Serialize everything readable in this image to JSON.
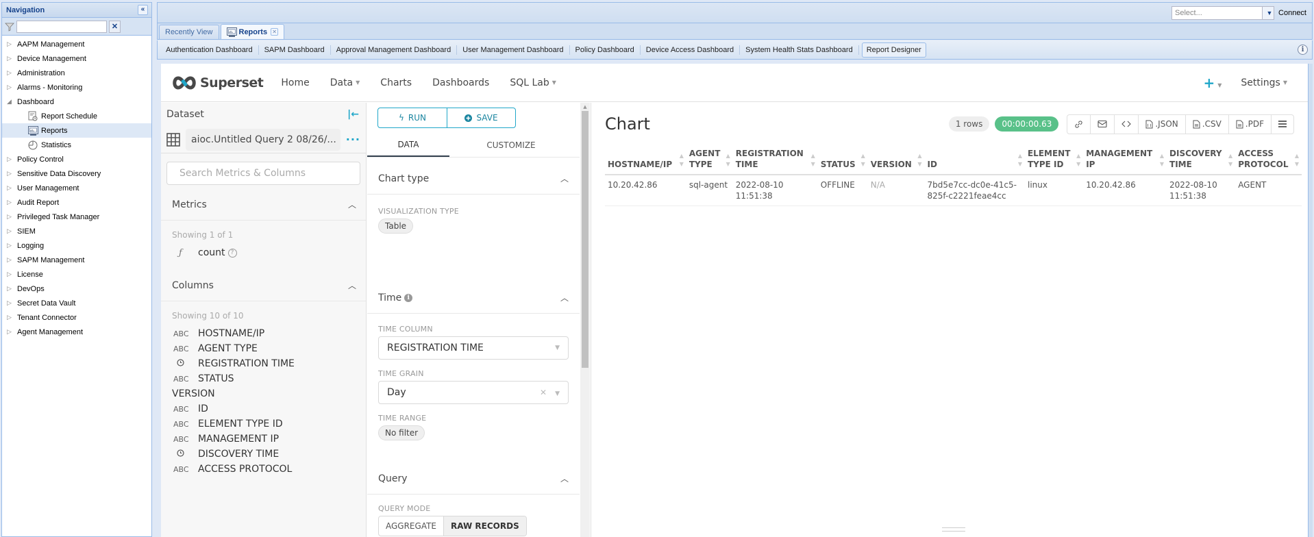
{
  "navigation": {
    "title": "Navigation",
    "filter_placeholder": "",
    "items": [
      {
        "label": "AAPM Management",
        "expanded": false
      },
      {
        "label": "Device Management",
        "expanded": false
      },
      {
        "label": "Administration",
        "expanded": false
      },
      {
        "label": "Alarms - Monitoring",
        "expanded": false
      },
      {
        "label": "Dashboard",
        "expanded": true,
        "children": [
          {
            "label": "Report Schedule",
            "icon": "report-schedule-icon"
          },
          {
            "label": "Reports",
            "icon": "reports-icon",
            "selected": true
          },
          {
            "label": "Statistics",
            "icon": "statistics-icon"
          }
        ]
      },
      {
        "label": "Policy Control",
        "expanded": false
      },
      {
        "label": "Sensitive Data Discovery",
        "expanded": false
      },
      {
        "label": "User Management",
        "expanded": false
      },
      {
        "label": "Audit Report",
        "expanded": false
      },
      {
        "label": "Privileged Task Manager",
        "expanded": false
      },
      {
        "label": "SIEM",
        "expanded": false
      },
      {
        "label": "Logging",
        "expanded": false
      },
      {
        "label": "SAPM Management",
        "expanded": false
      },
      {
        "label": "License",
        "expanded": false
      },
      {
        "label": "DevOps",
        "expanded": false
      },
      {
        "label": "Secret Data Vault",
        "expanded": false
      },
      {
        "label": "Tenant Connector",
        "expanded": false
      },
      {
        "label": "Agent Management",
        "expanded": false
      }
    ]
  },
  "topbar": {
    "select_placeholder": "Select...",
    "connect_label": "Connect"
  },
  "tabs": [
    {
      "label": "Recently View",
      "active": false
    },
    {
      "label": "Reports",
      "active": true,
      "closable": true
    }
  ],
  "subtabs": [
    {
      "label": "Authentication Dashboard"
    },
    {
      "label": "SAPM Dashboard"
    },
    {
      "label": "Approval Management Dashboard"
    },
    {
      "label": "User Management Dashboard"
    },
    {
      "label": "Policy Dashboard"
    },
    {
      "label": "Device Access Dashboard"
    },
    {
      "label": "System Health Stats Dashboard"
    },
    {
      "label": "Report Designer",
      "active": true
    }
  ],
  "superset": {
    "logo_text": "Superset",
    "menu": [
      {
        "label": "Home",
        "dropdown": false
      },
      {
        "label": "Data",
        "dropdown": true
      },
      {
        "label": "Charts",
        "dropdown": false
      },
      {
        "label": "Dashboards",
        "dropdown": false
      },
      {
        "label": "SQL Lab",
        "dropdown": true
      }
    ],
    "settings_label": "Settings",
    "accent_color": "#20a7c9"
  },
  "dataset": {
    "title": "Dataset",
    "name": "aioc.Untitled Query 2 08/26/...",
    "search_placeholder": "Search Metrics & Columns",
    "metrics": {
      "title": "Metrics",
      "showing": "Showing 1 of 1",
      "items": [
        {
          "type": "f",
          "label": "count"
        }
      ]
    },
    "columns": {
      "title": "Columns",
      "showing": "Showing 10 of 10",
      "items": [
        {
          "type": "ABC",
          "label": "HOSTNAME/IP"
        },
        {
          "type": "ABC",
          "label": "AGENT TYPE"
        },
        {
          "type": "clock",
          "label": "REGISTRATION TIME"
        },
        {
          "type": "ABC",
          "label": "STATUS"
        },
        {
          "type": "",
          "label": "VERSION"
        },
        {
          "type": "ABC",
          "label": "ID"
        },
        {
          "type": "ABC",
          "label": "ELEMENT TYPE ID"
        },
        {
          "type": "ABC",
          "label": "MANAGEMENT IP"
        },
        {
          "type": "clock",
          "label": "DISCOVERY TIME"
        },
        {
          "type": "ABC",
          "label": "ACCESS PROTOCOL"
        }
      ]
    }
  },
  "controls": {
    "run_label": "RUN",
    "save_label": "SAVE",
    "tabs": [
      {
        "label": "DATA",
        "active": true
      },
      {
        "label": "CUSTOMIZE",
        "active": false
      }
    ],
    "chart_type": {
      "title": "Chart type",
      "viz_label": "VISUALIZATION TYPE",
      "viz_value": "Table"
    },
    "time": {
      "title": "Time",
      "time_column_label": "TIME COLUMN",
      "time_column_value": "REGISTRATION TIME",
      "time_grain_label": "TIME GRAIN",
      "time_grain_value": "Day",
      "time_range_label": "TIME RANGE",
      "time_range_value": "No filter"
    },
    "query": {
      "title": "Query",
      "mode_label": "QUERY MODE",
      "modes": [
        {
          "label": "AGGREGATE",
          "active": false
        },
        {
          "label": "RAW RECORDS",
          "active": true
        }
      ]
    }
  },
  "chart": {
    "title": "Chart",
    "rows_badge": "1 rows",
    "time_badge": "00:00:00.63",
    "time_badge_color": "#59c189",
    "tools": [
      {
        "icon": "link-icon",
        "label": ""
      },
      {
        "icon": "email-icon",
        "label": ""
      },
      {
        "icon": "embed-code-icon",
        "label": ""
      },
      {
        "icon": "json-file-icon",
        "label": ".JSON"
      },
      {
        "icon": "csv-file-icon",
        "label": ".CSV"
      },
      {
        "icon": "pdf-file-icon",
        "label": ".PDF"
      },
      {
        "icon": "menu-icon",
        "label": ""
      }
    ],
    "table": {
      "headers": [
        [
          "HOSTNAME/IP"
        ],
        [
          "AGENT",
          "TYPE"
        ],
        [
          "REGISTRATION",
          "TIME"
        ],
        [
          "STATUS"
        ],
        [
          "VERSION"
        ],
        [
          "ID"
        ],
        [
          "ELEMENT",
          "TYPE ID"
        ],
        [
          "MANAGEMENT",
          "IP"
        ],
        [
          "DISCOVERY",
          "TIME"
        ],
        [
          "ACCESS",
          "PROTOCOL"
        ]
      ],
      "rows": [
        [
          [
            "10.20.42.86"
          ],
          [
            "sql-agent"
          ],
          [
            "2022-08-10",
            "11:51:38"
          ],
          [
            "OFFLINE"
          ],
          [
            "N/A"
          ],
          [
            "7bd5e7cc-dc0e-41c5-",
            "825f-c2221feae4cc"
          ],
          [
            "linux"
          ],
          [
            "10.20.42.86"
          ],
          [
            "2022-08-10",
            "11:51:38"
          ],
          [
            "AGENT"
          ]
        ]
      ]
    }
  }
}
